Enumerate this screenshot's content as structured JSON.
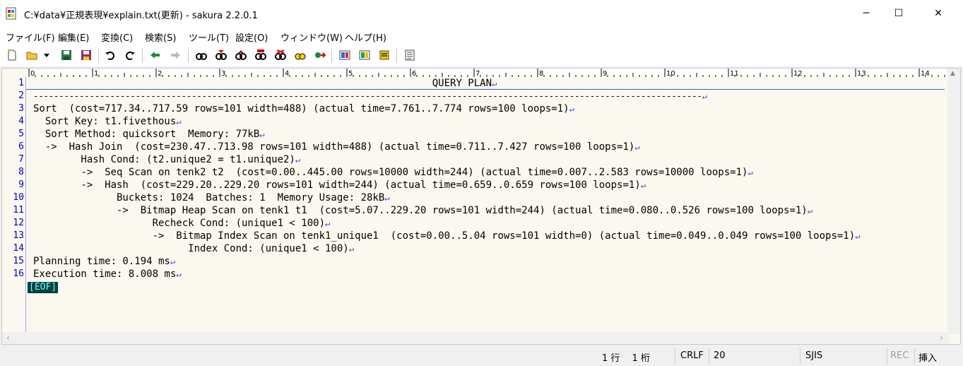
{
  "window": {
    "title": "C:¥data¥正規表現¥explain.txt(更新) - sakura 2.2.0.1"
  },
  "controls": {
    "minimize": "─",
    "maximize": "☐",
    "close": "✕"
  },
  "menu": [
    "ファイル(F)",
    "編集(E)",
    "変換(C)",
    "検索(S)",
    "ツール(T)",
    "設定(O)",
    "ウィンドウ(W)",
    "ヘルプ(H)"
  ],
  "ruler": [
    "0",
    "1",
    "2",
    "3",
    "4",
    "5",
    "6",
    "7",
    "8",
    "9",
    "10",
    "11",
    "12",
    "13",
    "14"
  ],
  "editor": {
    "lines": [
      {
        "no": "1",
        "text": "                                                                   QUERY PLAN"
      },
      {
        "no": "2",
        "text": "-----------------------------------------------------------------------------------------------------------------------------------"
      },
      {
        "no": "3",
        "text": "Sort  (cost=717.34..717.59 rows=101 width=488) (actual time=7.761..7.774 rows=100 loops=1)"
      },
      {
        "no": "4",
        "text": "  Sort Key: t1.fivethous"
      },
      {
        "no": "5",
        "text": "  Sort Method: quicksort  Memory: 77kB"
      },
      {
        "no": "6",
        "text": "  ->  Hash Join  (cost=230.47..713.98 rows=101 width=488) (actual time=0.711..7.427 rows=100 loops=1)"
      },
      {
        "no": "7",
        "text": "        Hash Cond: (t2.unique2 = t1.unique2)"
      },
      {
        "no": "8",
        "text": "        ->  Seq Scan on tenk2 t2  (cost=0.00..445.00 rows=10000 width=244) (actual time=0.007..2.583 rows=10000 loops=1)"
      },
      {
        "no": "9",
        "text": "        ->  Hash  (cost=229.20..229.20 rows=101 width=244) (actual time=0.659..0.659 rows=100 loops=1)"
      },
      {
        "no": "10",
        "text": "              Buckets: 1024  Batches: 1  Memory Usage: 28kB"
      },
      {
        "no": "11",
        "text": "              ->  Bitmap Heap Scan on tenk1 t1  (cost=5.07..229.20 rows=101 width=244) (actual time=0.080..0.526 rows=100 loops=1)"
      },
      {
        "no": "12",
        "text": "                    Recheck Cond: (unique1 < 100)"
      },
      {
        "no": "13",
        "text": "                    ->  Bitmap Index Scan on tenk1_unique1  (cost=0.00..5.04 rows=101 width=0) (actual time=0.049..0.049 rows=100 loops=1)"
      },
      {
        "no": "14",
        "text": "                          Index Cond: (unique1 < 100)"
      },
      {
        "no": "15",
        "text": "Planning time: 0.194 ms"
      },
      {
        "no": "16",
        "text": "Execution time: 8.008 ms"
      }
    ],
    "eof": "[EOF]",
    "newline_mark": "↵"
  },
  "status": {
    "position": "1 行　 1 桁",
    "eol": "CRLF",
    "char_code_hex": "20",
    "encoding": "SJIS",
    "rec": "REC",
    "insert_mode": "挿入"
  }
}
